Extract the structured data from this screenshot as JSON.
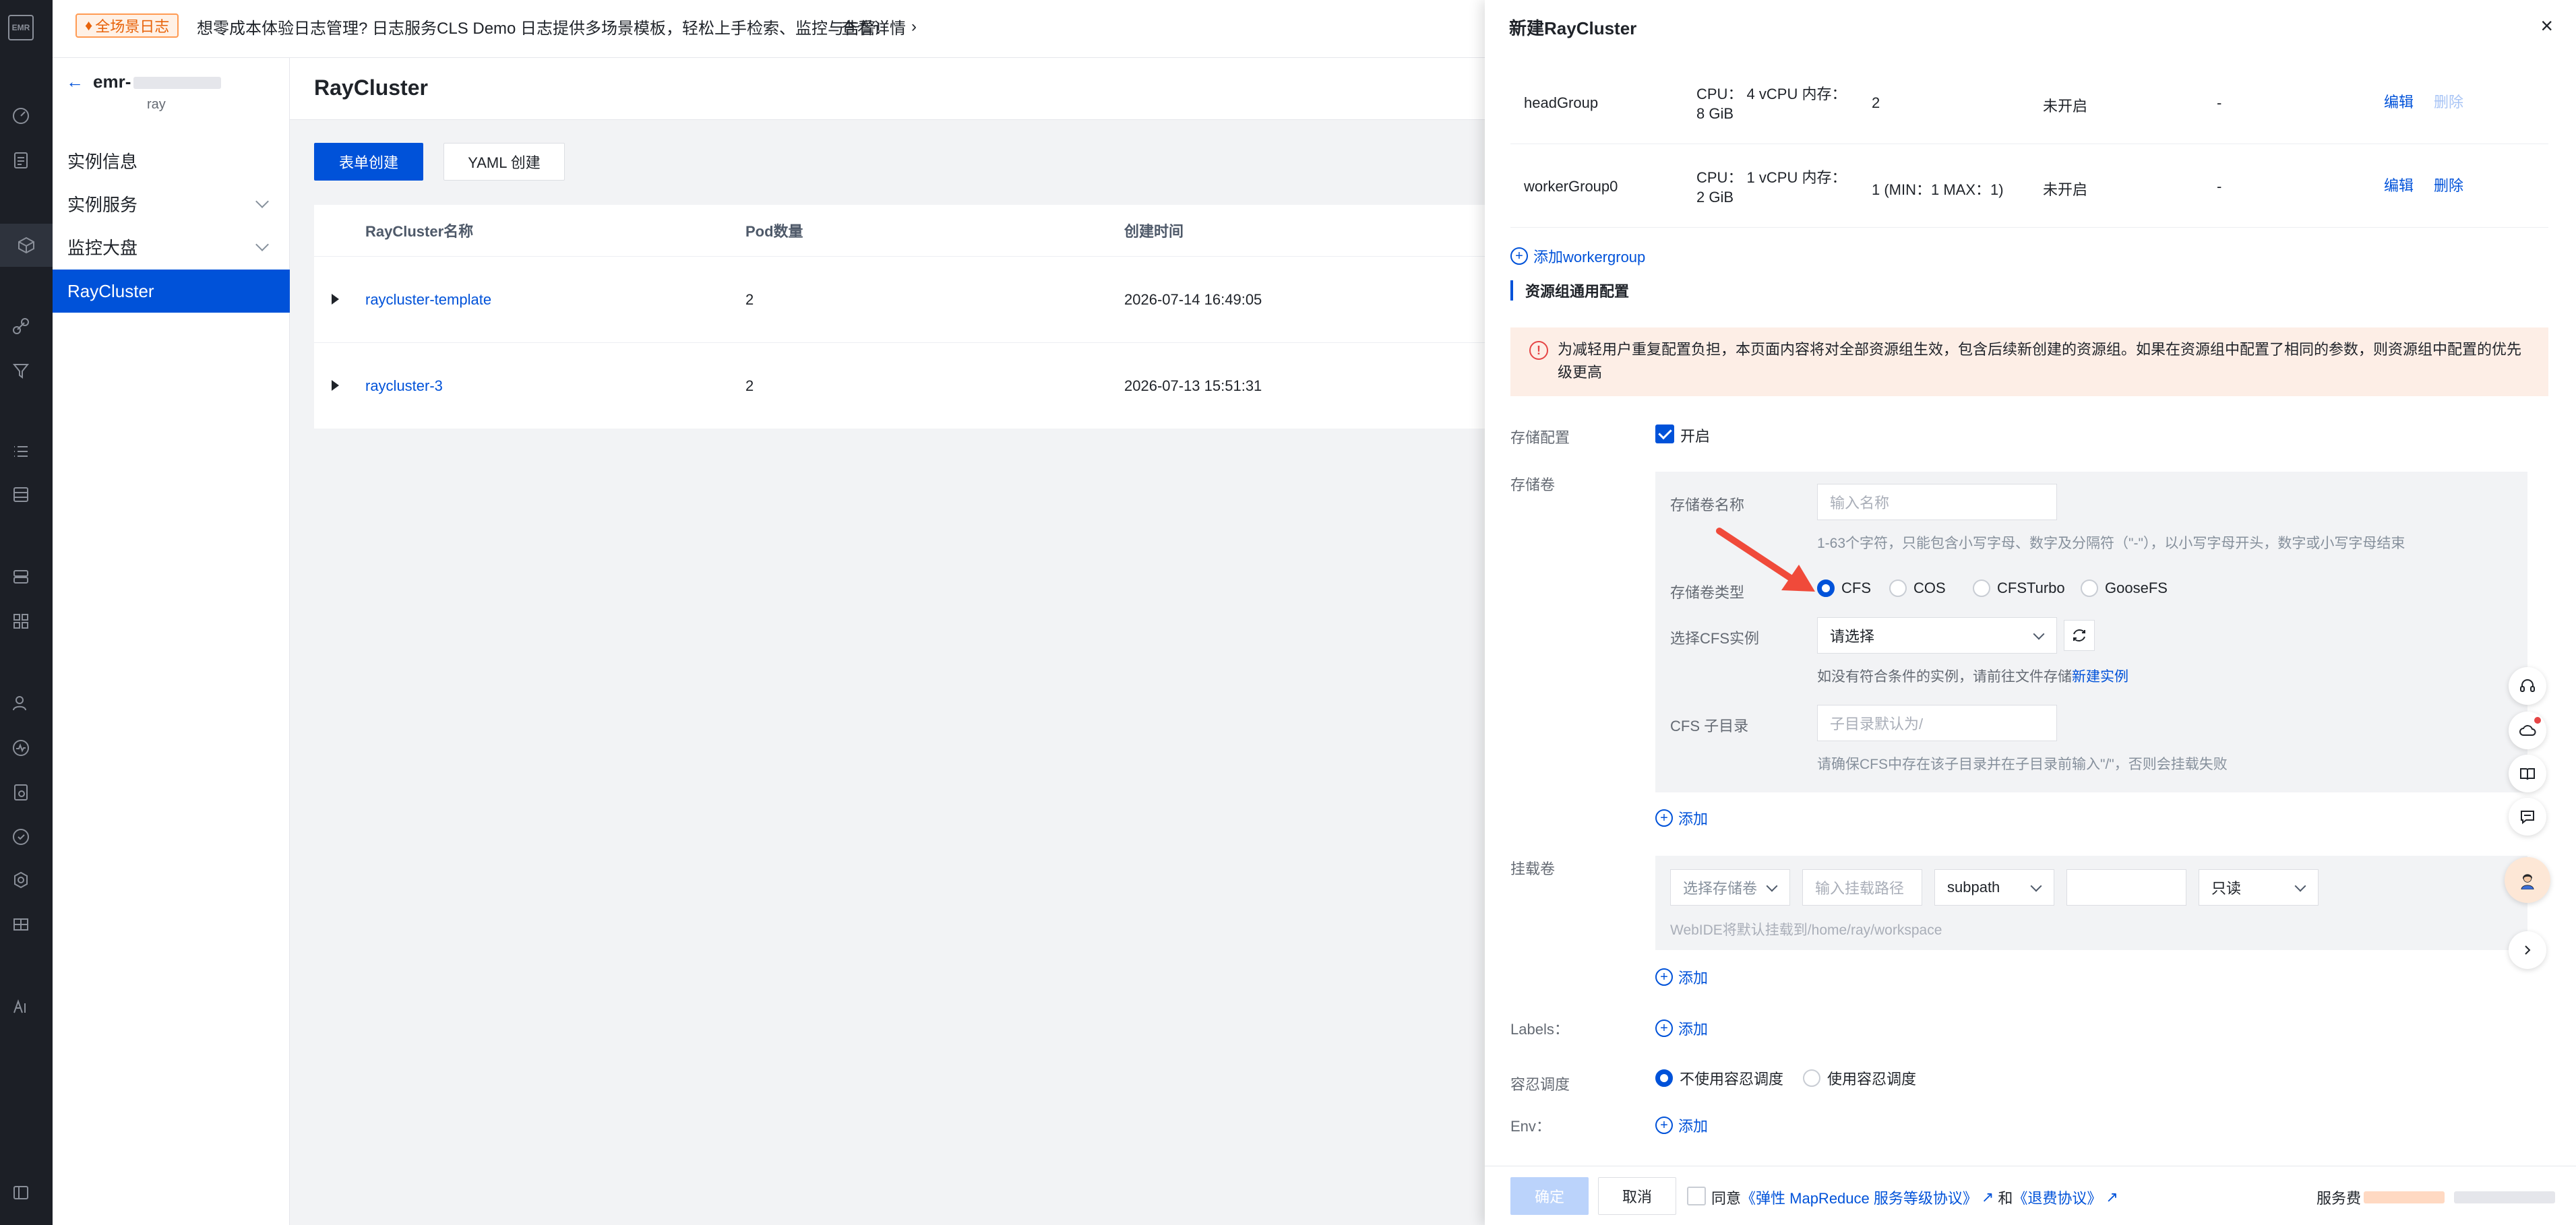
{
  "rail": {
    "logo": "EMR"
  },
  "banner": {
    "tag": "全场景日志",
    "text": "想零成本体验日志管理? 日志服务CLS Demo 日志提供多场景模板，轻松上手检索、监控与告警!",
    "link": "查看详情"
  },
  "sidebar": {
    "instance_name": "emr-",
    "instance_sub": "ray",
    "items": [
      {
        "label": "实例信息"
      },
      {
        "label": "实例服务"
      },
      {
        "label": "监控大盘"
      },
      {
        "label": "RayCluster"
      }
    ]
  },
  "main": {
    "title": "RayCluster",
    "form_create": "表单创建",
    "yaml_create": "YAML 创建",
    "columns": [
      "RayCluster名称",
      "Pod数量",
      "创建时间"
    ],
    "rows": [
      {
        "name": "raycluster-template",
        "pods": "2",
        "created": "2026-07-14 16:49:05"
      },
      {
        "name": "raycluster-3",
        "pods": "2",
        "created": "2026-07-13 15:51:31"
      }
    ]
  },
  "drawer": {
    "title": "新建RayCluster",
    "close": "×",
    "groups": [
      {
        "name": "headGroup",
        "spec_line1": "CPU：  4 vCPU 内存：",
        "spec_line2": "8 GiB",
        "count": "2",
        "autoscale": "未开启",
        "dash": "-",
        "edit": "编辑",
        "delete": "删除"
      },
      {
        "name": "workerGroup0",
        "spec_line1": "CPU：  1 vCPU 内存：",
        "spec_line2": "2 GiB",
        "count": "1 (MIN：1 MAX：1)",
        "autoscale": "未开启",
        "dash": "-",
        "edit": "编辑",
        "delete": "删除"
      }
    ],
    "add_workergroup": "添加workergroup",
    "section_title": "资源组通用配置",
    "alert": "为减轻用户重复配置负担，本页面内容将对全部资源组生效，包含后续新创建的资源组。如果在资源组中配置了相同的参数，则资源组中配置的优先级更高",
    "storage_config_label": "存储配置",
    "storage_enabled": "开启",
    "volume_label": "存储卷",
    "volume_name_label": "存储卷名称",
    "volume_name_placeholder": "输入名称",
    "volume_name_hint": "1-63个字符，只能包含小写字母、数字及分隔符（\"-\"），以小写字母开头，数字或小写字母结束",
    "volume_type_label": "存储卷类型",
    "volume_types": [
      "CFS",
      "COS",
      "CFSTurbo",
      "GooseFS"
    ],
    "cfs_instance_label": "选择CFS实例",
    "cfs_instance_placeholder": "请选择",
    "cfs_hint": "如没有符合条件的实例，请前往文件存储",
    "cfs_new_link": "新建实例",
    "cfs_subdir_label": "CFS 子目录",
    "cfs_subdir_placeholder": "子目录默认为/",
    "cfs_subdir_hint": "请确保CFS中存在该子目录并在子目录前输入\"/\"，否则会挂载失败",
    "add": "添加",
    "mount_label": "挂载卷",
    "mount_select": "选择存储卷",
    "mount_path_placeholder": "输入挂载路径",
    "mount_subpath": "subpath",
    "mount_mode": "只读",
    "mount_hint": "WebIDE将默认挂载到/home/ray/workspace",
    "labels_label": "Labels：",
    "toleration_label": "容忍调度",
    "toleration_options": [
      "不使用容忍调度",
      "使用容忍调度"
    ],
    "env_label": "Env："
  },
  "footer": {
    "confirm": "确定",
    "cancel": "取消",
    "agree": "同意",
    "agreement1": "《弹性 MapReduce 服务等级协议》",
    "and": "和",
    "agreement2": "《退费协议》",
    "fee_label": "服务费"
  },
  "colors": {
    "primary": "#0052d9",
    "alert_bg": "#fdeee6",
    "banner_tag": "#e8630a",
    "arrow": "#f04a3a"
  }
}
